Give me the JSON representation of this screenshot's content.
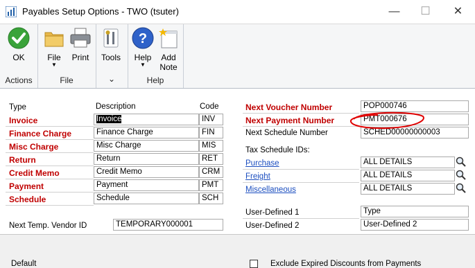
{
  "window": {
    "title": "Payables Setup Options  -  TWO (tsuter)",
    "minimize_glyph": "—",
    "restore_glyph": "☐",
    "close_glyph": "✕"
  },
  "ribbon": {
    "ok_label": "OK",
    "file_label": "File",
    "print_label": "Print",
    "tools_label": "Tools",
    "help_label": "Help",
    "add_note_label_1": "Add",
    "add_note_label_2": "Note",
    "group_actions": "Actions",
    "group_file": "File",
    "group_help": "Help",
    "dropdown_glyph": "▼",
    "tools_group_glyph": "⌄"
  },
  "left_grid": {
    "col_type": "Type",
    "col_description": "Description",
    "col_code": "Code",
    "rows": [
      {
        "type": "Invoice",
        "description": "Invoice",
        "code": "INV"
      },
      {
        "type": "Finance Charge",
        "description": "Finance Charge",
        "code": "FIN"
      },
      {
        "type": "Misc Charge",
        "description": "Misc Charge",
        "code": "MIS"
      },
      {
        "type": "Return",
        "description": "Return",
        "code": "RET"
      },
      {
        "type": "Credit Memo",
        "description": "Credit  Memo",
        "code": "CRM"
      },
      {
        "type": "Payment",
        "description": "Payment",
        "code": "PMT"
      },
      {
        "type": "Schedule",
        "description": "Schedule",
        "code": "SCH"
      }
    ],
    "temp_vendor_label": "Next Temp. Vendor ID",
    "temp_vendor_value": "TEMPORARY000001"
  },
  "right_panel": {
    "next_voucher_label": "Next Voucher Number",
    "next_voucher_value": "POP000746",
    "next_payment_label": "Next Payment Number",
    "next_payment_value": "PMT000676",
    "next_schedule_label": "Next Schedule Number",
    "next_schedule_value": "SCHED00000000003",
    "tax_ids_label": "Tax Schedule IDs:",
    "purchase_label": "Purchase",
    "purchase_value": "ALL DETAILS",
    "freight_label": "Freight",
    "freight_value": "ALL DETAILS",
    "misc_label": "Miscellaneous",
    "misc_value": "ALL DETAILS",
    "udf1_label": "User-Defined 1",
    "udf1_value": "Type",
    "udf2_label": "User-Defined 2",
    "udf2_value": "User-Defined 2"
  },
  "bottom": {
    "partial_left": "Default",
    "partial_right": "Exclude Expired Discounts from Payments"
  },
  "colors": {
    "accent_red": "#c00000",
    "link_blue": "#1a4dbf",
    "annotation_red": "#e00000"
  }
}
